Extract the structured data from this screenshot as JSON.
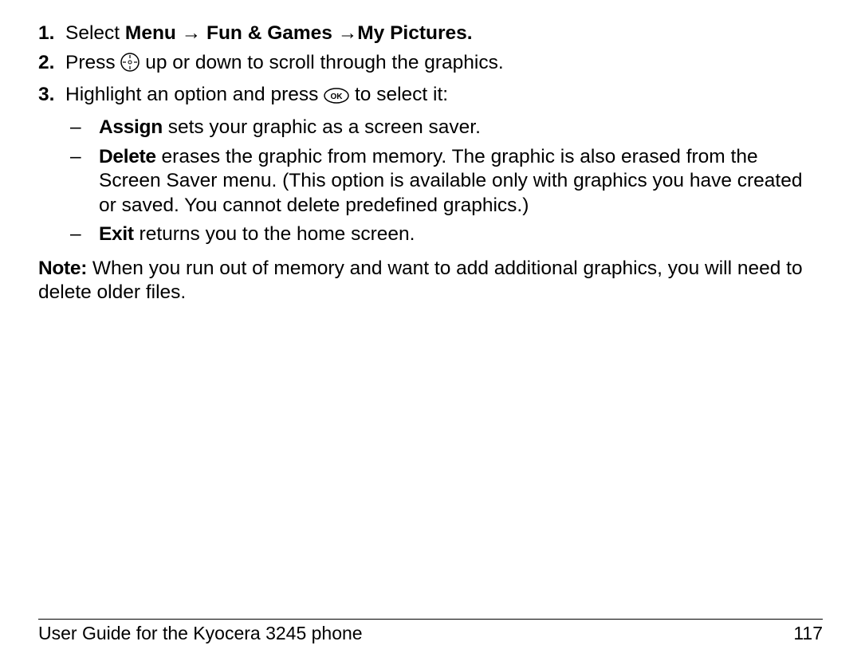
{
  "steps": {
    "s1": {
      "num": "1.",
      "select": "Select ",
      "menu": "Menu",
      "arr1": " → ",
      "fun": "Fun & Games",
      "arr2": " →",
      "mypics": "My Pictures."
    },
    "s2": {
      "num": "2.",
      "press": "Press ",
      "suffix": " up or down to scroll through the graphics."
    },
    "s3": {
      "num": "3.",
      "prefix": "Highlight an option and press ",
      "suffix": " to select it:"
    }
  },
  "sub": {
    "dash": "–",
    "assign_b": "Assign",
    "assign_t": " sets your graphic as a screen saver.",
    "delete_b": "Delete",
    "delete_t": " erases the graphic from memory. The graphic is also erased from the Screen Saver menu. (This option is available only with graphics you have created or saved. You cannot delete predefined graphics.)",
    "exit_b": "Exit",
    "exit_t": " returns you to the home screen."
  },
  "note": {
    "label": "Note:",
    "text": " When you run out of memory and want to add additional graphics, you will need to delete older files."
  },
  "footer": {
    "title": "User Guide for the Kyocera 3245 phone",
    "page": "117"
  }
}
